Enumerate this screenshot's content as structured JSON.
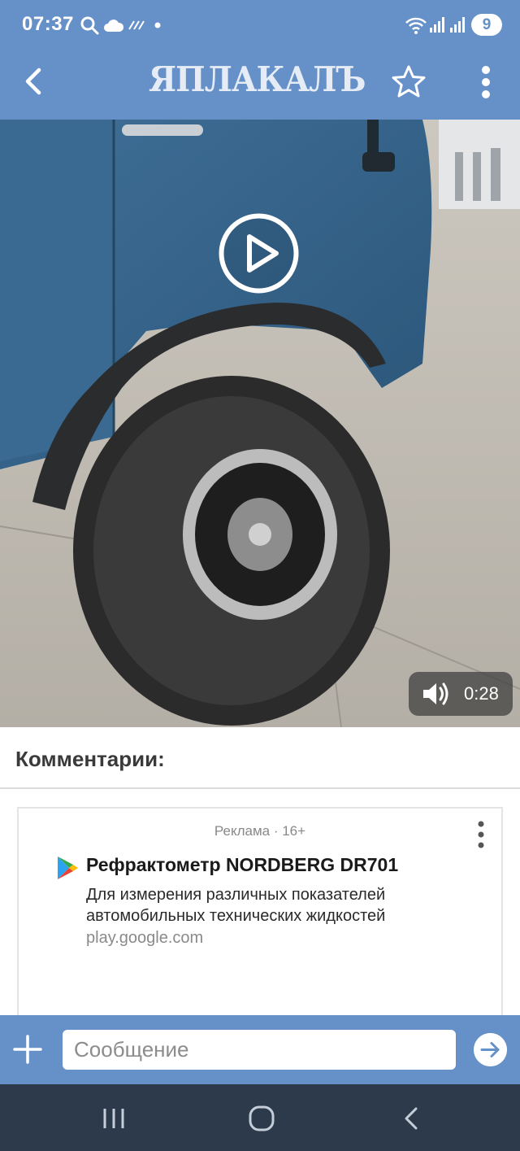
{
  "status_bar": {
    "time": "07:37",
    "left_icons": [
      "search-icon",
      "cloud-icon",
      "striped-flag-icon",
      "dot-icon"
    ],
    "right_icons": [
      "wifi-icon",
      "signal-icon",
      "signal-icon"
    ],
    "notification_count": "9"
  },
  "app_bar": {
    "logo_text": "ЯПЛАКАЛЪ",
    "back_icon": "chevron-left-icon",
    "favorite_icon": "star-outline-icon",
    "menu_icon": "more-vertical-icon"
  },
  "video": {
    "duration": "0:28",
    "play_icon": "play-icon",
    "volume_icon": "volume-icon"
  },
  "comments": {
    "title": "Комментарии:"
  },
  "ad": {
    "label": "Реклама · 16+",
    "title": "Рефрактометр NORDBERG DR701",
    "description": "Для измерения различных показателей автомобильных технических жидкостей",
    "url": "play.google.com",
    "store_icon": "google-play-icon"
  },
  "composer": {
    "placeholder": "Сообщение",
    "value": ""
  },
  "colors": {
    "brand": "#6690c8",
    "nav_bar": "#2c3a4c"
  }
}
